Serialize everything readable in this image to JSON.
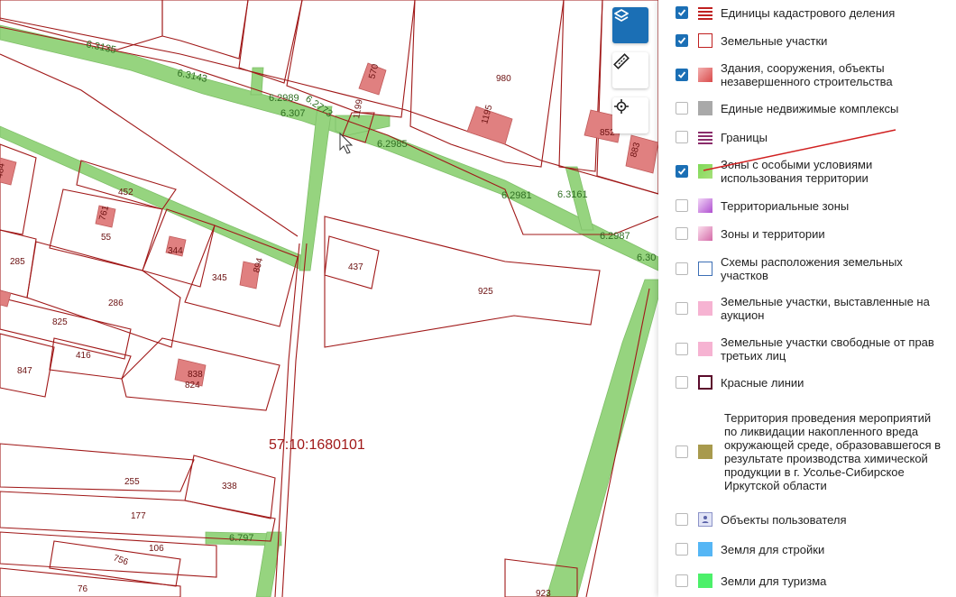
{
  "map": {
    "quarter_label": "57:10:1680101",
    "parcel_labels": [
      "980",
      "570",
      "1199",
      "1195",
      "852",
      "883",
      "484",
      "452",
      "761",
      "55",
      "344",
      "345",
      "894",
      "285",
      "286",
      "825",
      "416",
      "847",
      "838",
      "824",
      "437",
      "925",
      "255",
      "338",
      "177",
      "106",
      "756",
      "76",
      "923"
    ],
    "zone_labels": [
      "6.3135",
      "6.3143",
      "6.2989",
      "6.2773",
      "6.307",
      "6.2985",
      "6.2981",
      "6.3161",
      "6.2987",
      "6.30",
      "6.797"
    ]
  },
  "toolbar": {
    "layers_icon": "layers-icon",
    "ruler_icon": "ruler-icon",
    "locate_icon": "crosshair-icon"
  },
  "legend": {
    "items": [
      {
        "label": "Единицы кадастрового деления",
        "checked": true,
        "swatch": "stripes-red"
      },
      {
        "label": "Земельные участки",
        "checked": true,
        "swatch": "outline-red"
      },
      {
        "label": "Здания, сооружения, объекты незавершенного строительства",
        "checked": true,
        "swatch": "gradient-red"
      },
      {
        "label": "Единые недвижимые комплексы",
        "checked": false,
        "swatch": "gray"
      },
      {
        "label": "Границы",
        "checked": false,
        "swatch": "stripes-purple"
      },
      {
        "label": "Зоны с особыми условиями использования территории",
        "checked": true,
        "swatch": "green"
      },
      {
        "label": "Территориальные зоны",
        "checked": false,
        "swatch": "gradient-violet"
      },
      {
        "label": "Зоны и территории",
        "checked": false,
        "swatch": "gradient-pink"
      },
      {
        "label": "Схемы расположения земельных участков",
        "checked": false,
        "swatch": "outline-blue"
      },
      {
        "label": "Земельные участки, выставленные на аукцион",
        "checked": false,
        "swatch": "pink"
      },
      {
        "label": "Земельные участки свободные от прав третьих лиц",
        "checked": false,
        "swatch": "pink"
      },
      {
        "label": "Красные линии",
        "checked": false,
        "swatch": "outline-darkred"
      },
      {
        "label": "Территория проведения мероприятий по ликвидации накопленного вреда окружающей среде, образовавшегося в результате производства химической продукции в г. Усолье-Сибирское Иркутской области",
        "checked": false,
        "swatch": "olive"
      },
      {
        "label": "Объекты пользователя",
        "checked": false,
        "swatch": "user-icon"
      },
      {
        "label": "Земля для стройки",
        "checked": false,
        "swatch": "light-blue"
      },
      {
        "label": "Земли для туризма",
        "checked": false,
        "swatch": "bright-green"
      }
    ]
  },
  "colors": {
    "accent": "#1b6fb5",
    "parcel_line": "#a01818",
    "zone_fill": "#96d47f",
    "building": "#e08080",
    "annotation_arrow": "#d02020"
  }
}
